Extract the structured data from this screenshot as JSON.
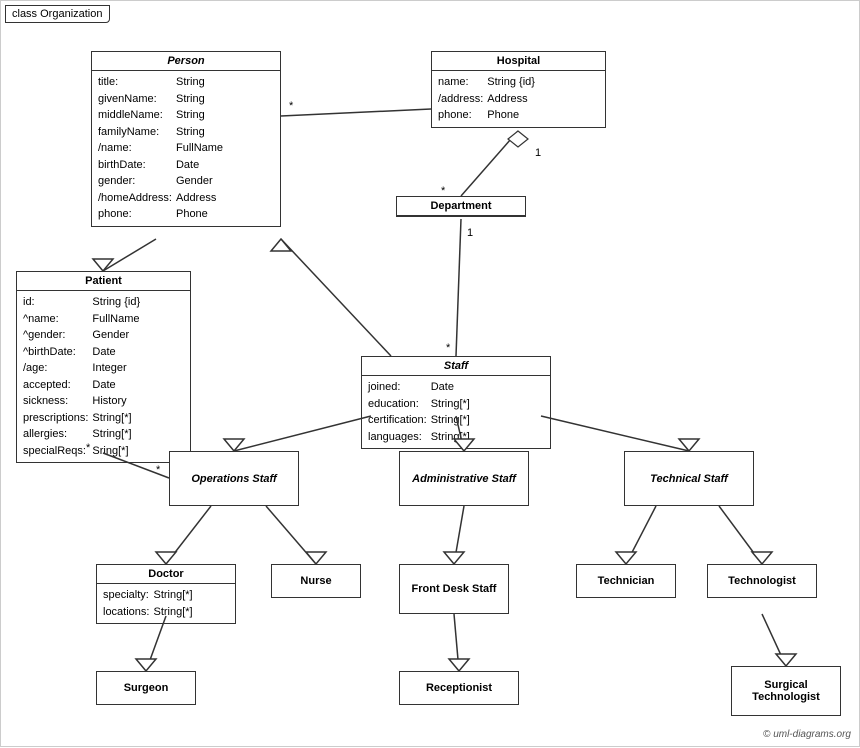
{
  "diagram_title": "class Organization",
  "copyright": "© uml-diagrams.org",
  "classes": {
    "person": {
      "title": "Person",
      "attrs": [
        [
          "title:",
          "String"
        ],
        [
          "givenName:",
          "String"
        ],
        [
          "middleName:",
          "String"
        ],
        [
          "familyName:",
          "String"
        ],
        [
          "/name:",
          "FullName"
        ],
        [
          "birthDate:",
          "Date"
        ],
        [
          "gender:",
          "Gender"
        ],
        [
          "/homeAddress:",
          "Address"
        ],
        [
          "phone:",
          "Phone"
        ]
      ]
    },
    "hospital": {
      "title": "Hospital",
      "attrs": [
        [
          "name:",
          "String {id}"
        ],
        [
          "/address:",
          "Address"
        ],
        [
          "phone:",
          "Phone"
        ]
      ]
    },
    "patient": {
      "title": "Patient",
      "attrs": [
        [
          "id:",
          "String {id}"
        ],
        [
          "^name:",
          "FullName"
        ],
        [
          "^gender:",
          "Gender"
        ],
        [
          "^birthDate:",
          "Date"
        ],
        [
          "/age:",
          "Integer"
        ],
        [
          "accepted:",
          "Date"
        ],
        [
          "sickness:",
          "History"
        ],
        [
          "prescriptions:",
          "String[*]"
        ],
        [
          "allergies:",
          "String[*]"
        ],
        [
          "specialReqs:",
          "Sring[*]"
        ]
      ]
    },
    "department": {
      "title": "Department"
    },
    "staff": {
      "title": "Staff",
      "attrs": [
        [
          "joined:",
          "Date"
        ],
        [
          "education:",
          "String[*]"
        ],
        [
          "certification:",
          "String[*]"
        ],
        [
          "languages:",
          "String[*]"
        ]
      ]
    },
    "operations_staff": {
      "title": "Operations Staff"
    },
    "administrative_staff": {
      "title": "Administrative Staff"
    },
    "technical_staff": {
      "title": "Technical Staff"
    },
    "doctor": {
      "title": "Doctor",
      "attrs": [
        [
          "specialty:",
          "String[*]"
        ],
        [
          "locations:",
          "String[*]"
        ]
      ]
    },
    "nurse": {
      "title": "Nurse"
    },
    "front_desk_staff": {
      "title": "Front Desk Staff"
    },
    "technician": {
      "title": "Technician"
    },
    "technologist": {
      "title": "Technologist"
    },
    "surgeon": {
      "title": "Surgeon"
    },
    "receptionist": {
      "title": "Receptionist"
    },
    "surgical_technologist": {
      "title": "Surgical Technologist"
    }
  },
  "multiplicity": {
    "star": "*",
    "one": "1"
  }
}
